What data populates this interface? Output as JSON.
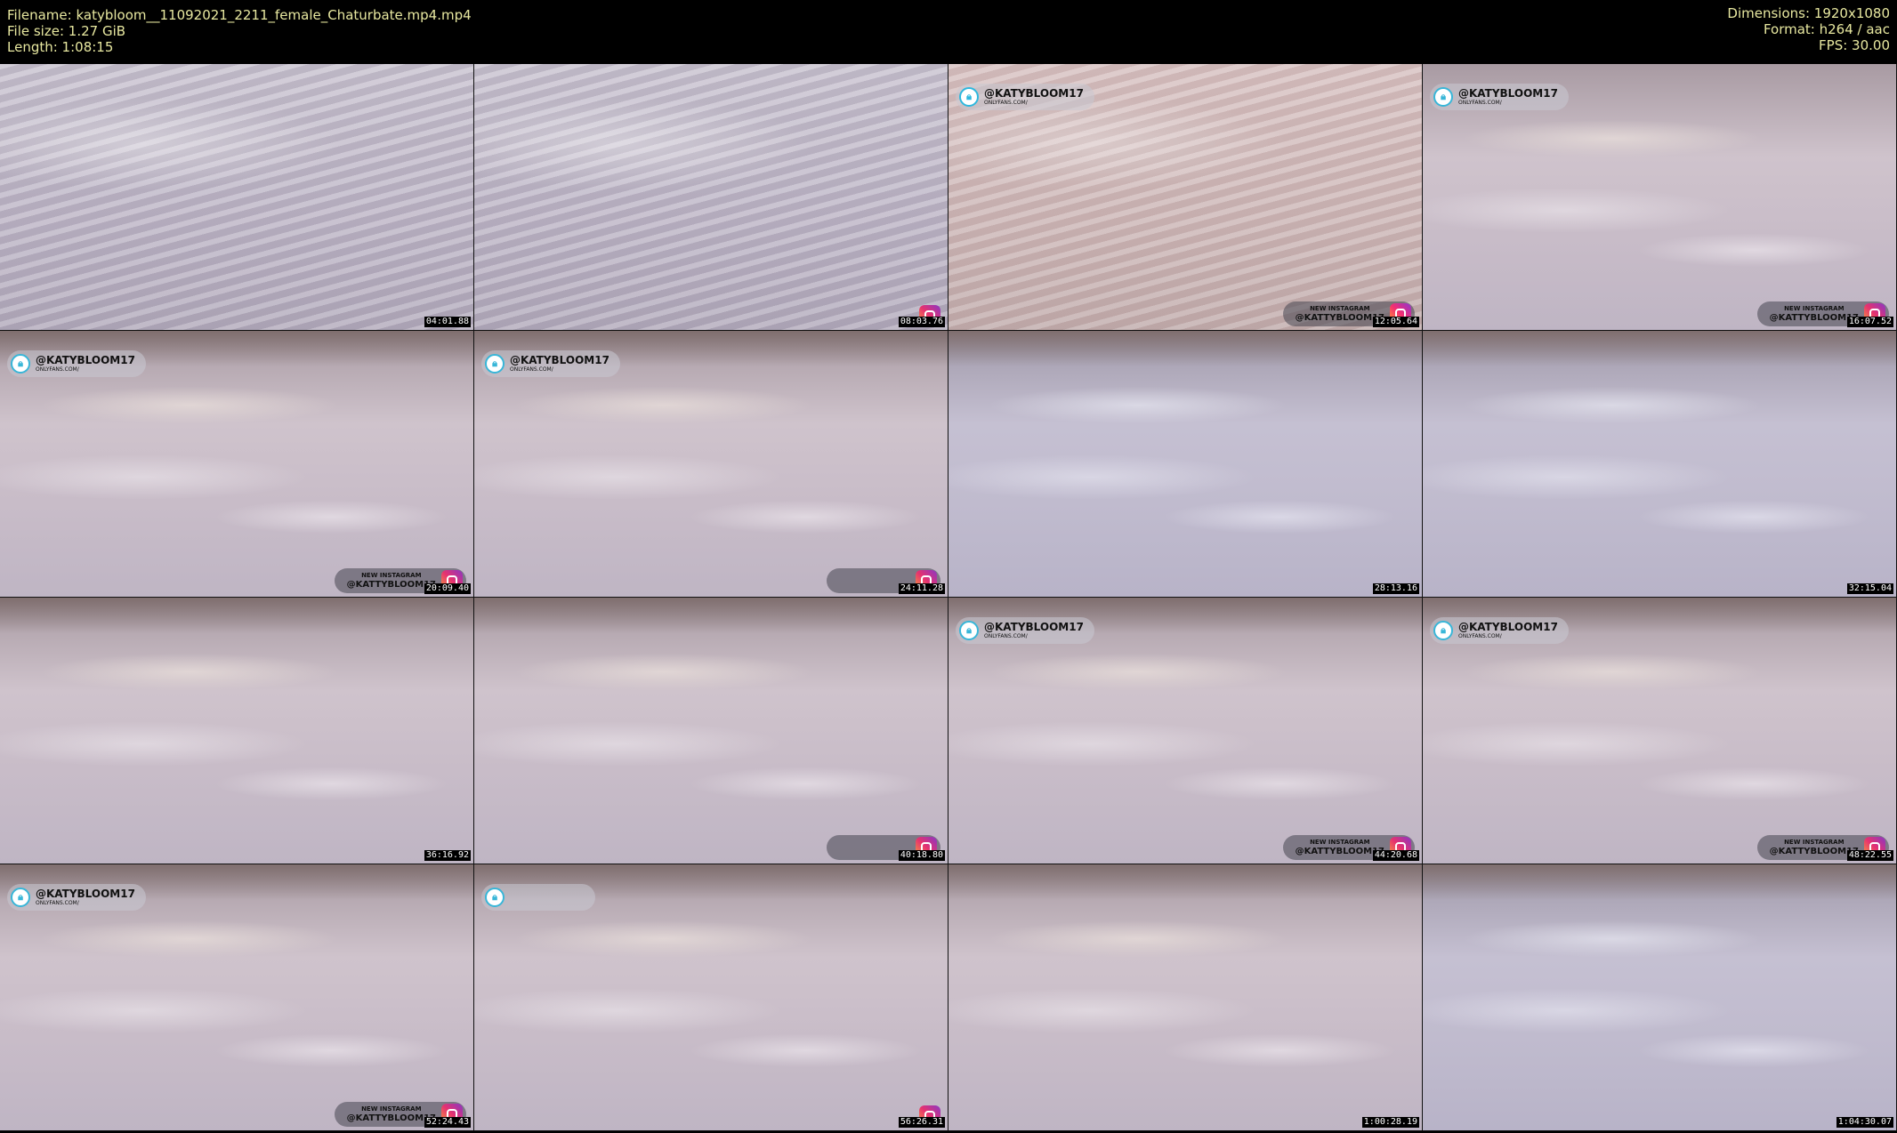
{
  "header": {
    "filename": "Filename: katybloom__11092021_2211_female_Chaturbate.mp4.mp4",
    "filesize": "File size: 1.27 GiB",
    "length": "Length: 1:08:15",
    "dimensions": "Dimensions: 1920x1080",
    "format": "Format: h264 / aac",
    "fps": "FPS: 30.00"
  },
  "overlay": {
    "of_handle": "@KATYBLOOM17",
    "of_sub": "ONLYFANS.COM/",
    "ig_line1": "NEW INSTAGRAM",
    "ig_line2": "@KATTYBLOOM17"
  },
  "thumbnails": [
    {
      "time": "04:01.88"
    },
    {
      "time": "08:03.76"
    },
    {
      "time": "12:05.64"
    },
    {
      "time": "16:07.52"
    },
    {
      "time": "20:09.40"
    },
    {
      "time": "24:11.28"
    },
    {
      "time": "28:13.16"
    },
    {
      "time": "32:15.04"
    },
    {
      "time": "36:16.92"
    },
    {
      "time": "40:18.80"
    },
    {
      "time": "44:20.68"
    },
    {
      "time": "48:22.55"
    },
    {
      "time": "52:24.43"
    },
    {
      "time": "56:26.31"
    },
    {
      "time": "1:00:28.19"
    },
    {
      "time": "1:04:30.07"
    }
  ],
  "icons": {
    "onlyfans": "lock-icon",
    "instagram": "instagram-icon"
  },
  "colors": {
    "header_text": "#e8e8a0",
    "background": "#000000",
    "onlyfans_accent": "#38b6d8"
  }
}
